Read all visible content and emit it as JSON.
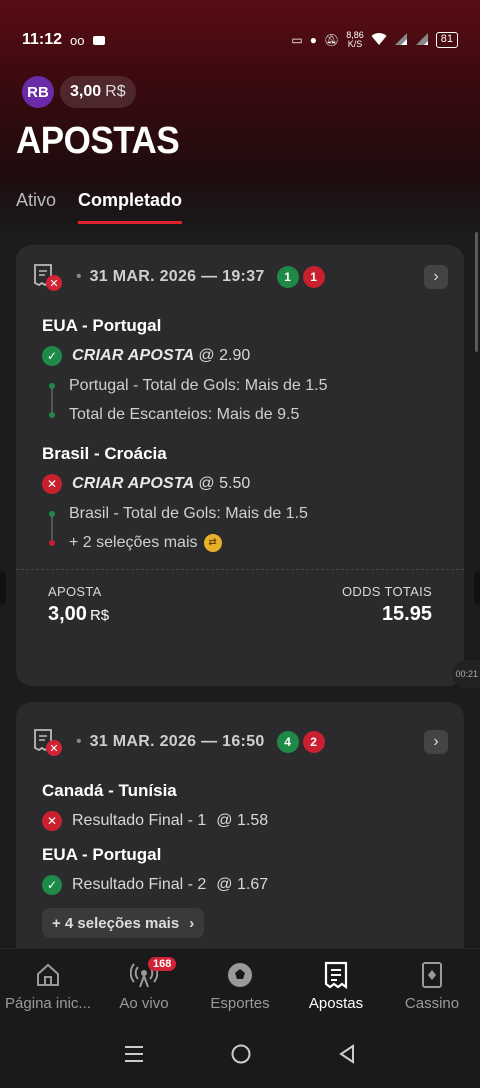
{
  "status": {
    "time": "11:12",
    "speed": "8,86",
    "speed_unit": "K/S",
    "battery": "81"
  },
  "account": {
    "initials": "RB",
    "balance": "3,00",
    "currency": "R$"
  },
  "page_title": "APOSTAS",
  "tabs": [
    {
      "label": "Ativo"
    },
    {
      "label": "Completado"
    }
  ],
  "bets": [
    {
      "date": "31 MAR. 2026 — 19:37",
      "wins": "1",
      "losses": "1",
      "matches": [
        {
          "title": "EUA - Portugal",
          "bet_label": "CRIAR APOSTA",
          "odds": "@ 2.90",
          "legs": [
            "Portugal - Total de Gols: Mais de 1.5",
            "Total de Escanteios: Mais de 9.5"
          ]
        },
        {
          "title": "Brasil - Croácia",
          "bet_label": "CRIAR APOSTA",
          "odds": "@ 5.50",
          "legs": [
            "Brasil - Total de Gols: Mais de 1.5",
            "+ 2 seleções mais"
          ]
        }
      ],
      "stake_label": "APOSTA",
      "stake": "3,00",
      "stake_currency": "R$",
      "total_odds_label": "ODDS TOTAIS",
      "total_odds": "15.95"
    },
    {
      "date": "31 MAR. 2026 — 16:50",
      "wins": "4",
      "losses": "2",
      "matches": [
        {
          "title": "Canadá - Tunísia",
          "selection": "Resultado Final - 1",
          "odds": "@ 1.58"
        },
        {
          "title": "EUA - Portugal",
          "selection": "Resultado Final - 2",
          "odds": "@ 1.67"
        }
      ],
      "more_label": "+ 4 seleções mais"
    }
  ],
  "timer_chip": "00:21",
  "bottom_nav": [
    {
      "label": "Página inic...",
      "icon": "home-icon"
    },
    {
      "label": "Ao vivo",
      "icon": "live-icon",
      "badge": "168"
    },
    {
      "label": "Esportes",
      "icon": "soccer-ball-icon"
    },
    {
      "label": "Apostas",
      "icon": "betslip-icon"
    },
    {
      "label": "Cassino",
      "icon": "cards-icon"
    }
  ]
}
